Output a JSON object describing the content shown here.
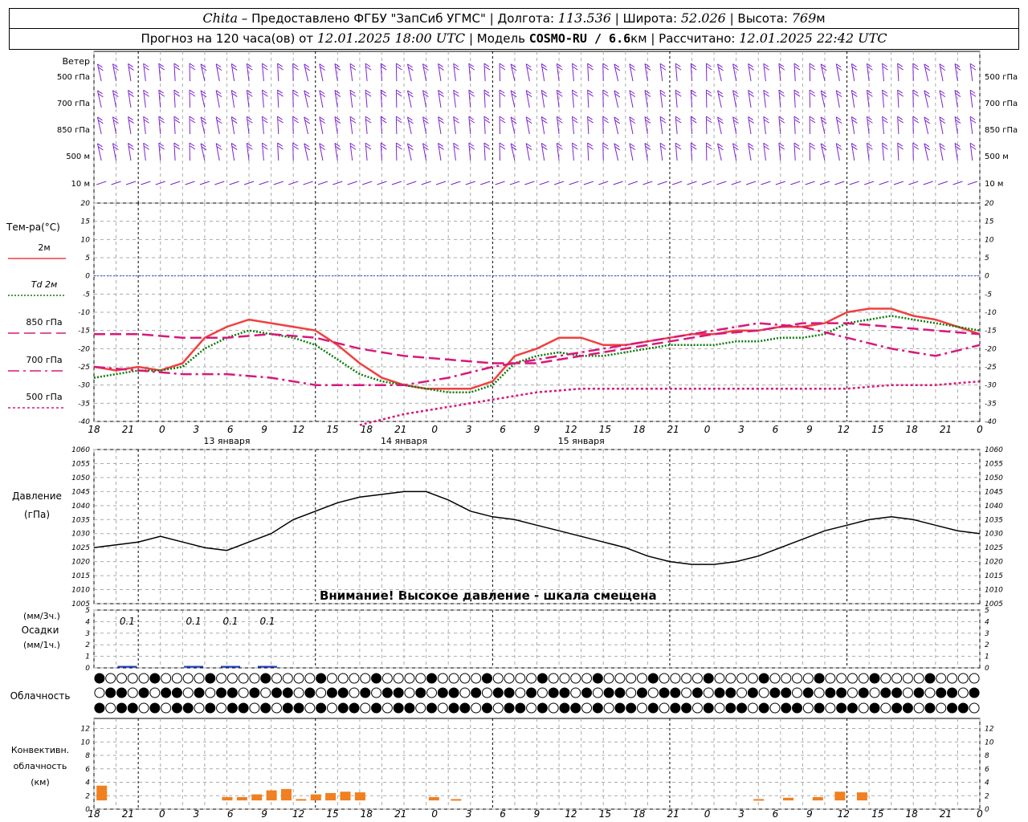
{
  "header": {
    "station": "Chita",
    "provider": "Предоставлено ФГБУ \"ЗапСиб УГМС\"",
    "lon_label": "Долгота:",
    "lon_value": "113.536",
    "lat_label": "Широта:",
    "lat_value": "52.026",
    "alt_label": "Высота:",
    "alt_value": "769",
    "alt_unit": "м",
    "forecast_label": "Прогноз на 120 часа(ов) от",
    "forecast_date": "12.01.2025 18:00 UTC",
    "model_label": "Модель",
    "model_name": "COSMO-RU / 6.6",
    "model_unit": "км",
    "calc_label": "Рассчитано:",
    "calc_date": "12.01.2025 22:42 UTC"
  },
  "wind_panel": {
    "title": "Ветер",
    "levels": [
      "500 гПа",
      "700 гПа",
      "850 гПа",
      "500 м",
      "10 м"
    ],
    "barb_color": "#7b22d0"
  },
  "temp_panel": {
    "title": "Тем-ра(°С)",
    "legend": [
      {
        "label": "2м",
        "color": "#f04040",
        "style": "solid"
      },
      {
        "label": "Td 2м",
        "color": "#0b7a0b",
        "style": "dotted"
      },
      {
        "label": "850 гПа",
        "color": "#d8187a",
        "style": "dash"
      },
      {
        "label": "700 гПа",
        "color": "#d8187a",
        "style": "dashdot"
      },
      {
        "label": "500 гПа",
        "color": "#d8187a",
        "style": "dot"
      }
    ],
    "y_ticks": [
      "20",
      "15",
      "10",
      "5",
      "0",
      "-5",
      "-10",
      "-15",
      "-20",
      "-25",
      "-30",
      "-35",
      "-40"
    ]
  },
  "pressure_panel": {
    "title": "Давление",
    "unit": "(гПа)",
    "warning": "Внимание! Высокое давление - шкала смещена",
    "y_ticks": [
      "1060",
      "1055",
      "1050",
      "1045",
      "1040",
      "1035",
      "1030",
      "1025",
      "1020",
      "1015",
      "1010",
      "1005"
    ]
  },
  "precip_panel": {
    "unit3": "(мм/3ч.)",
    "title": "Осадки",
    "unit1": "(мм/1ч.)",
    "y_ticks": [
      "5",
      "4",
      "3",
      "2",
      "1",
      "0"
    ],
    "amount_labels": [
      "0.1",
      "0.1",
      "0.1",
      "0.1"
    ]
  },
  "cloud_panel": {
    "title": "Облачность"
  },
  "conv_panel": {
    "title_line1": "Конвективн.",
    "title_line2": "облачность",
    "unit": "(км)",
    "y_ticks": [
      "12",
      "10",
      "8",
      "6",
      "4",
      "2",
      "0"
    ]
  },
  "time_axis": {
    "hour_labels": [
      "18",
      "21",
      "0",
      "3",
      "6",
      "9",
      "12",
      "15",
      "18",
      "21",
      "0",
      "3",
      "6",
      "9",
      "12",
      "15",
      "18",
      "21",
      "0",
      "3",
      "6",
      "9",
      "12",
      "15",
      "18",
      "21",
      "0"
    ],
    "day_labels": [
      "13 января",
      "14 января",
      "15 января"
    ]
  },
  "chart_data": [
    {
      "type": "line",
      "title": "Тем-ра(°С)",
      "x_unit": "hours from 12.01.2025 18:00 UTC",
      "ylim": [
        -40,
        20
      ],
      "series": [
        {
          "name": "2м",
          "color": "#f04040",
          "x": [
            0,
            3,
            6,
            9,
            12,
            15,
            18,
            21,
            24,
            27,
            30,
            33,
            36,
            39,
            42,
            45,
            48,
            51,
            54,
            57,
            60,
            63,
            66,
            69,
            72,
            75,
            78,
            81,
            84,
            87,
            90,
            93,
            96,
            99,
            102,
            105,
            108,
            111,
            114,
            117,
            120
          ],
          "y": [
            -25,
            -26,
            -25,
            -26,
            -24,
            -17,
            -14,
            -12,
            -13,
            -14,
            -15,
            -19,
            -24,
            -28,
            -30,
            -31,
            -31,
            -31,
            -29,
            -22,
            -20,
            -17,
            -17,
            -19,
            -19,
            -18,
            -17,
            -16,
            -16,
            -15,
            -15,
            -14,
            -14,
            -13,
            -10,
            -9,
            -9,
            -11,
            -12,
            -14,
            -16
          ]
        },
        {
          "name": "Td 2м",
          "color": "#0b7a0b",
          "x": [
            0,
            3,
            6,
            9,
            12,
            15,
            18,
            21,
            24,
            27,
            30,
            33,
            36,
            39,
            42,
            45,
            48,
            51,
            54,
            57,
            60,
            63,
            66,
            69,
            72,
            75,
            78,
            81,
            84,
            87,
            90,
            93,
            96,
            99,
            102,
            105,
            108,
            111,
            114,
            117,
            120
          ],
          "y": [
            -28,
            -27,
            -26,
            -26,
            -25,
            -20,
            -17,
            -15,
            -16,
            -17,
            -19,
            -23,
            -27,
            -29,
            -30,
            -31,
            -32,
            -32,
            -30,
            -24,
            -22,
            -21,
            -22,
            -22,
            -21,
            -20,
            -19,
            -19,
            -19,
            -18,
            -18,
            -17,
            -17,
            -16,
            -13,
            -12,
            -11,
            -12,
            -13,
            -14,
            -15
          ]
        },
        {
          "name": "850 гПа",
          "color": "#d8187a",
          "x": [
            0,
            6,
            12,
            18,
            24,
            30,
            36,
            42,
            48,
            54,
            60,
            66,
            72,
            78,
            84,
            90,
            96,
            102,
            108,
            114,
            120
          ],
          "y": [
            -16,
            -16,
            -17,
            -17,
            -16,
            -17,
            -20,
            -22,
            -23,
            -24,
            -24,
            -22,
            -20,
            -18,
            -16,
            -15,
            -13,
            -13,
            -14,
            -15,
            -16
          ]
        },
        {
          "name": "700 гПа",
          "color": "#d8187a",
          "x": [
            0,
            6,
            12,
            18,
            24,
            30,
            36,
            42,
            48,
            54,
            60,
            66,
            72,
            78,
            84,
            90,
            96,
            102,
            108,
            114,
            120
          ],
          "y": [
            -25,
            -26,
            -27,
            -27,
            -28,
            -30,
            -30,
            -30,
            -28,
            -25,
            -23,
            -21,
            -19,
            -17,
            -15,
            -13,
            -14,
            -17,
            -20,
            -22,
            -19
          ]
        },
        {
          "name": "500 гПа",
          "color": "#d8187a",
          "x": [
            36,
            42,
            48,
            54,
            60,
            66,
            72,
            78,
            84,
            90,
            96,
            102,
            108,
            114,
            120
          ],
          "y": [
            -41,
            -38,
            -36,
            -34,
            -32,
            -31,
            -31,
            -31,
            -31,
            -31,
            -31,
            -31,
            -30,
            -30,
            -29
          ]
        }
      ]
    },
    {
      "type": "line",
      "title": "Давление",
      "x_unit": "hours from 12.01.2025 18:00 UTC",
      "ylim": [
        1005,
        1060
      ],
      "series": [
        {
          "name": "Давление",
          "color": "#000000",
          "x": [
            0,
            3,
            6,
            9,
            12,
            15,
            18,
            21,
            24,
            27,
            30,
            33,
            36,
            39,
            42,
            45,
            48,
            51,
            54,
            57,
            60,
            63,
            66,
            69,
            72,
            75,
            78,
            81,
            84,
            87,
            90,
            93,
            96,
            99,
            102,
            105,
            108,
            111,
            114,
            117,
            120
          ],
          "y": [
            1025,
            1026,
            1027,
            1029,
            1027,
            1025,
            1024,
            1027,
            1030,
            1035,
            1038,
            1041,
            1043,
            1044,
            1045,
            1045,
            1042,
            1038,
            1036,
            1035,
            1033,
            1031,
            1029,
            1027,
            1025,
            1022,
            1020,
            1019,
            1019,
            1020,
            1022,
            1025,
            1028,
            1031,
            1033,
            1035,
            1036,
            1035,
            1033,
            1031,
            1030
          ]
        }
      ]
    },
    {
      "type": "bar",
      "title": "Осадки",
      "x_unit": "hours from 12.01.2025 18:00 UTC",
      "ylim": [
        0,
        5
      ],
      "series": [
        {
          "name": "Осадки",
          "color": "#1e3cc8",
          "x": [
            4.5,
            13.5,
            18.5,
            23.5
          ],
          "y": [
            0.1,
            0.1,
            0.1,
            0.1
          ]
        }
      ]
    },
    {
      "type": "bar",
      "title": "Конвективн. облачность",
      "x_unit": "hours from 12.01.2025 18:00 UTC",
      "ylim": [
        0,
        13
      ],
      "series": [
        {
          "name": "верхняя граница (км)",
          "color": "#f08020",
          "x": [
            1,
            18,
            20,
            22,
            24,
            26,
            28,
            30,
            32,
            34,
            36,
            46,
            49,
            90,
            94,
            98,
            101,
            104
          ],
          "y": [
            3.5,
            1.8,
            1.8,
            2.2,
            2.8,
            3,
            1.5,
            2.2,
            2.4,
            2.6,
            2.5,
            1.8,
            1.5,
            1.5,
            1.7,
            1.8,
            2.6,
            2.5
          ]
        }
      ]
    }
  ]
}
